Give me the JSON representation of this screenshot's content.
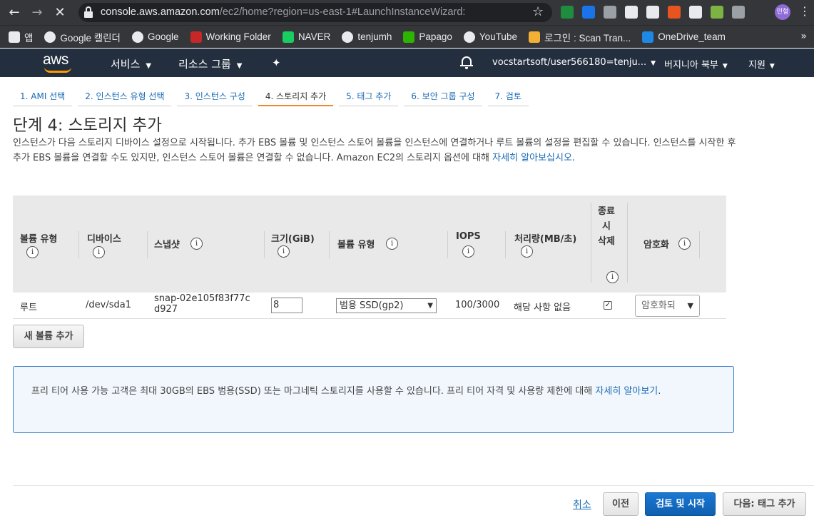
{
  "browser": {
    "url_host": "console.aws.amazon.com",
    "url_path": "/ec2/home?region=us-east-1#LaunchInstanceWizard:",
    "profile_label": "민형",
    "bookmarks": [
      {
        "label": "앱",
        "icon": "apps-grid-icon",
        "color": "#e8eaed"
      },
      {
        "label": "Google 캘린더",
        "icon": "google-icon",
        "color": "#e8eaed"
      },
      {
        "label": "Google",
        "icon": "google-icon",
        "color": "#e8eaed"
      },
      {
        "label": "Working Folder",
        "icon": "folder-icon",
        "color": "#c62828"
      },
      {
        "label": "NAVER",
        "icon": "naver-icon",
        "color": "#19ce60"
      },
      {
        "label": "tenjumh",
        "icon": "github-icon",
        "color": "#e8eaed"
      },
      {
        "label": "Papago",
        "icon": "papago-icon",
        "color": "#2db400"
      },
      {
        "label": "YouTube",
        "icon": "globe-icon",
        "color": "#e8eaed"
      },
      {
        "label": "로그인 : Scan Tran...",
        "icon": "scan-icon",
        "color": "#f2b134"
      },
      {
        "label": "OneDrive_team",
        "icon": "onedrive-icon",
        "color": "#1e88e5"
      }
    ],
    "extensions": [
      "#1e8e3e",
      "#1a73e8",
      "#9aa0a6",
      "#e8eaed",
      "#e8eaed",
      "#e8541f",
      "#e8eaed",
      "#7cb342",
      "#9aa0a6"
    ]
  },
  "aws": {
    "logo": "aws",
    "menu_services": "서비스",
    "menu_resource_groups": "리소스 그룹",
    "account": "vocstartsoft/user566180=tenju...",
    "region": "버지니아 북부",
    "support": "지원"
  },
  "steps": [
    {
      "label": "1. AMI 선택",
      "active": false
    },
    {
      "label": "2. 인스턴스 유형 선택",
      "active": false
    },
    {
      "label": "3. 인스턴스 구성",
      "active": false
    },
    {
      "label": "4. 스토리지 추가",
      "active": true
    },
    {
      "label": "5. 태그 추가",
      "active": false
    },
    {
      "label": "6. 보안 그룹 구성",
      "active": false
    },
    {
      "label": "7. 검토",
      "active": false
    }
  ],
  "page": {
    "title": "단계 4: 스토리지 추가",
    "description": "인스턴스가 다음 스토리지 디바이스 설정으로 시작됩니다. 추가 EBS 볼륨 및 인스턴스 스토어 볼륨을 인스턴스에 연결하거나 루트 볼륨의 설정을 편집할 수 있습니다. 인스턴스를 시작한 후 추가 EBS 볼륨을 연결할 수도 있지만, 인스턴스 스토어 볼륨은 연결할 수 없습니다. Amazon EC2의 스토리지 옵션에 대해 ",
    "description_link": "자세히 알아보십시오",
    "description_end": "."
  },
  "table": {
    "headers": {
      "volume_type": "볼륨 유형",
      "device": "디바이스",
      "snapshot": "스냅샷",
      "size": "크기(GiB)",
      "volume_kind": "볼륨 유형",
      "iops": "IOPS",
      "throughput": "처리량(MB/초)",
      "delete_on_termination": "종료 시 삭제",
      "encryption": "암호화"
    },
    "row": {
      "volume_type": "루트",
      "device": "/dev/sda1",
      "snapshot": "snap-02e105f83f77cd927",
      "size": "8",
      "volume_kind": "범용 SSD(gp2)",
      "iops": "100/3000",
      "throughput": "해당 사항 없음",
      "delete_on_termination": true,
      "encryption": "암호화되"
    }
  },
  "add_volume_label": "새 볼륨 추가",
  "free_tier": {
    "text": "프리 티어 사용 가능 고객은 최대 30GB의 EBS 범용(SSD) 또는 마그네틱 스토리지를 사용할 수 있습니다. 프리 티어 자격 및 사용량 제한에 대해 ",
    "link": "자세히 알아보기",
    "end": "."
  },
  "footer": {
    "cancel": "취소",
    "previous": "이전",
    "review_launch": "검토 및 시작",
    "next": "다음: 태그 추가"
  },
  "colors": {
    "aws_nav_bg": "#232f3e",
    "aws_orange": "#ff9900",
    "link_blue": "#1a6bb5",
    "primary_button": "#1a78d4",
    "info_border": "#3a7bc8",
    "active_step_underline": "#e98c2e"
  }
}
